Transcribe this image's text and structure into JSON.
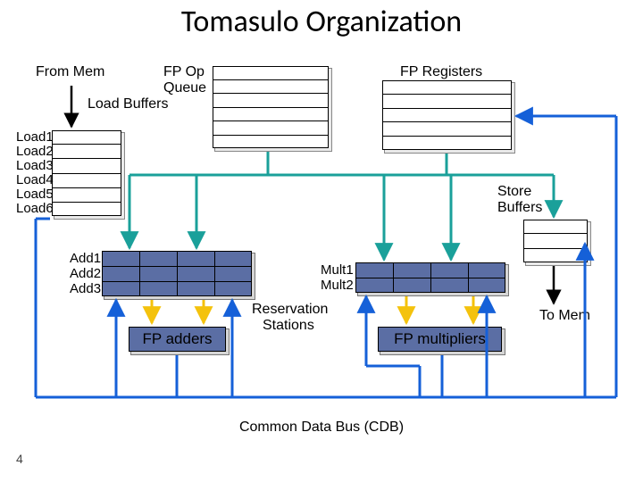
{
  "title": "Tomasulo Organization",
  "labels": {
    "from_mem": "From Mem",
    "fp_op_queue_1": "FP Op",
    "fp_op_queue_2": "Queue",
    "load_buffers": "Load Buffers",
    "fp_registers": "FP Registers",
    "store_buffers_1": "Store",
    "store_buffers_2": "Buffers",
    "reservation_stations_1": "Reservation",
    "reservation_stations_2": "Stations",
    "to_mem": "To Mem",
    "cdb": "Common Data Bus (CDB)"
  },
  "loads": [
    "Load1",
    "Load2",
    "Load3",
    "Load4",
    "Load5",
    "Load6"
  ],
  "adds": [
    "Add1",
    "Add2",
    "Add3"
  ],
  "mults": [
    "Mult1",
    "Mult2"
  ],
  "fu": {
    "adders": "FP adders",
    "multipliers": "FP multipliers"
  },
  "pagenum": "4",
  "colors": {
    "block_fill": "#5b6ea4",
    "bus_blue": "#1560d8",
    "bus_teal": "#1aa09a",
    "bus_yellow": "#f4c20d"
  }
}
